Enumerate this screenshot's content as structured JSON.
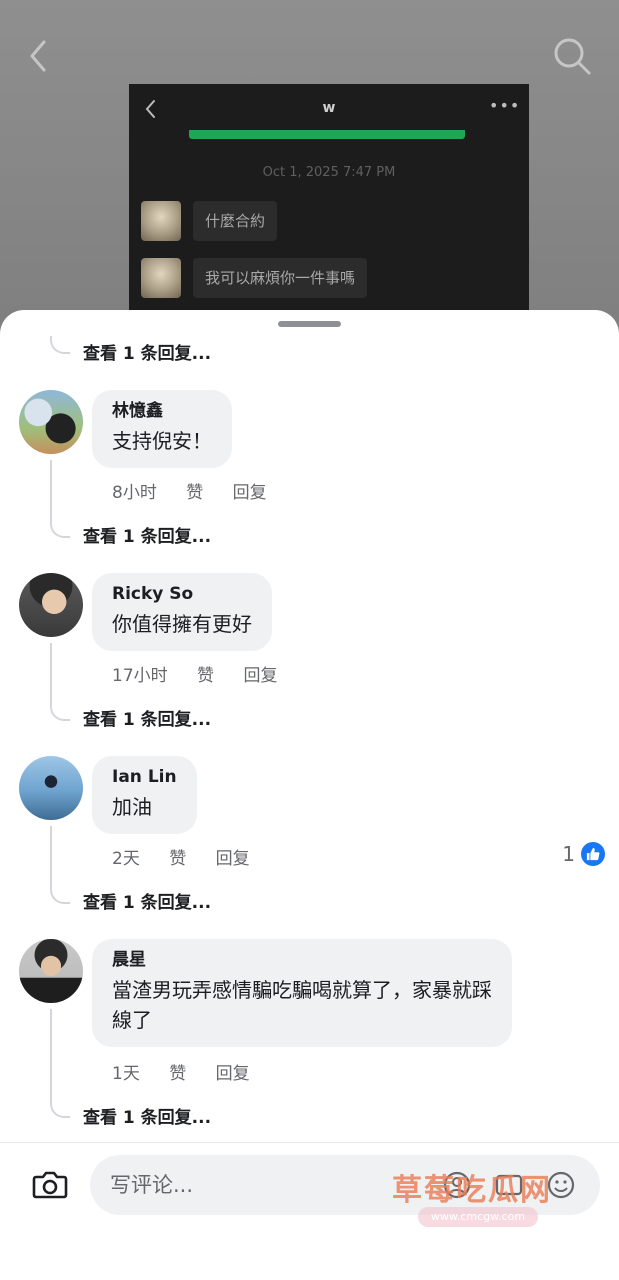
{
  "post": {
    "screenshot": {
      "title": "w",
      "more": "•••",
      "timestamp": "Oct 1, 2025 7:47 PM",
      "messages": [
        "什麼合約",
        "我可以麻煩你一件事嗎"
      ]
    }
  },
  "comments": {
    "view_replies_label": "查看 1 条回复...",
    "items": [
      {
        "author": "林憶鑫",
        "text": "支持倪安！",
        "time": "8小时",
        "like_label": "赞",
        "reply_label": "回复"
      },
      {
        "author": "Ricky So",
        "text": "你值得擁有更好",
        "time": "17小时",
        "like_label": "赞",
        "reply_label": "回复"
      },
      {
        "author": "Ian Lin",
        "text": "加油",
        "time": "2天",
        "like_label": "赞",
        "reply_label": "回复",
        "reactions": "1"
      },
      {
        "author": "晨星",
        "text_lines": [
          "當渣男玩弄感情騙吃騙喝就算了，家暴就踩",
          "線了"
        ],
        "time": "1天",
        "like_label": "赞",
        "reply_label": "回复"
      }
    ]
  },
  "composer": {
    "placeholder": "写评论...",
    "watermark": "草莓吃瓜网",
    "watermark_url": "www.cmcgw.com"
  },
  "colors": {
    "accent": "#1877f2",
    "bubble": "#f0f1f3",
    "wechat_green": "#1fa654"
  }
}
